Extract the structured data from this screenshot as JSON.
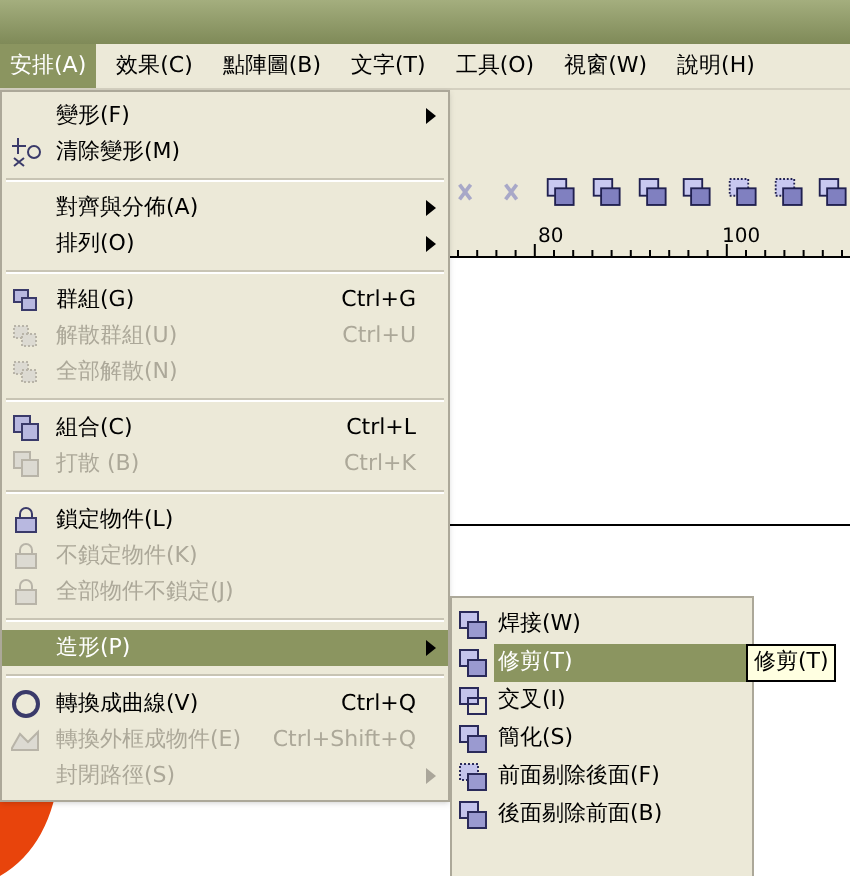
{
  "menu_bar": [
    {
      "label": "安排(A)",
      "selected": true
    },
    {
      "label": "效果(C)",
      "selected": false
    },
    {
      "label": "點陣圖(B)",
      "selected": false
    },
    {
      "label": "文字(T)",
      "selected": false
    },
    {
      "label": "工具(O)",
      "selected": false
    },
    {
      "label": "視窗(W)",
      "selected": false
    },
    {
      "label": "說明(H)",
      "selected": false
    }
  ],
  "ruler": {
    "labels": [
      "80",
      "100"
    ]
  },
  "menu": [
    {
      "label": "變形(F)",
      "submenu": true,
      "disabled": false,
      "selected": false
    },
    {
      "label": "清除變形(M)",
      "disabled": false,
      "selected": false,
      "separator_after": true
    },
    {
      "label": "對齊與分佈(A)",
      "submenu": true,
      "disabled": false,
      "selected": false
    },
    {
      "label": "排列(O)",
      "submenu": true,
      "disabled": false,
      "selected": false,
      "separator_after": true
    },
    {
      "label": "群組(G)",
      "shortcut": "Ctrl+G",
      "disabled": false,
      "selected": false
    },
    {
      "label": "解散群組(U)",
      "shortcut": "Ctrl+U",
      "disabled": true,
      "selected": false
    },
    {
      "label": "全部解散(N)",
      "disabled": true,
      "selected": false,
      "separator_after": true
    },
    {
      "label": "組合(C)",
      "shortcut": "Ctrl+L",
      "disabled": false,
      "selected": false
    },
    {
      "label": "打散 (B)",
      "shortcut": "Ctrl+K",
      "disabled": true,
      "selected": false,
      "separator_after": true
    },
    {
      "label": "鎖定物件(L)",
      "disabled": false,
      "selected": false
    },
    {
      "label": "不鎖定物件(K)",
      "disabled": true,
      "selected": false
    },
    {
      "label": "全部物件不鎖定(J)",
      "disabled": true,
      "selected": false,
      "separator_after": true
    },
    {
      "label": "造形(P)",
      "submenu": true,
      "disabled": false,
      "selected": true,
      "separator_after": true
    },
    {
      "label": "轉換成曲線(V)",
      "shortcut": "Ctrl+Q",
      "disabled": false,
      "selected": false
    },
    {
      "label": "轉換外框成物件(E)",
      "shortcut": "Ctrl+Shift+Q",
      "disabled": true,
      "selected": false
    },
    {
      "label": "封閉路徑(S)",
      "submenu": true,
      "disabled": true,
      "selected": false
    }
  ],
  "submenu": [
    {
      "label": "焊接(W)",
      "selected": false
    },
    {
      "label": "修剪(T)",
      "selected": true
    },
    {
      "label": "交叉(I)",
      "selected": false
    },
    {
      "label": "簡化(S)",
      "selected": false
    },
    {
      "label": "前面剔除後面(F)",
      "selected": false
    },
    {
      "label": "後面剔除前面(B)",
      "selected": false
    }
  ],
  "tooltip": "修剪(T)"
}
